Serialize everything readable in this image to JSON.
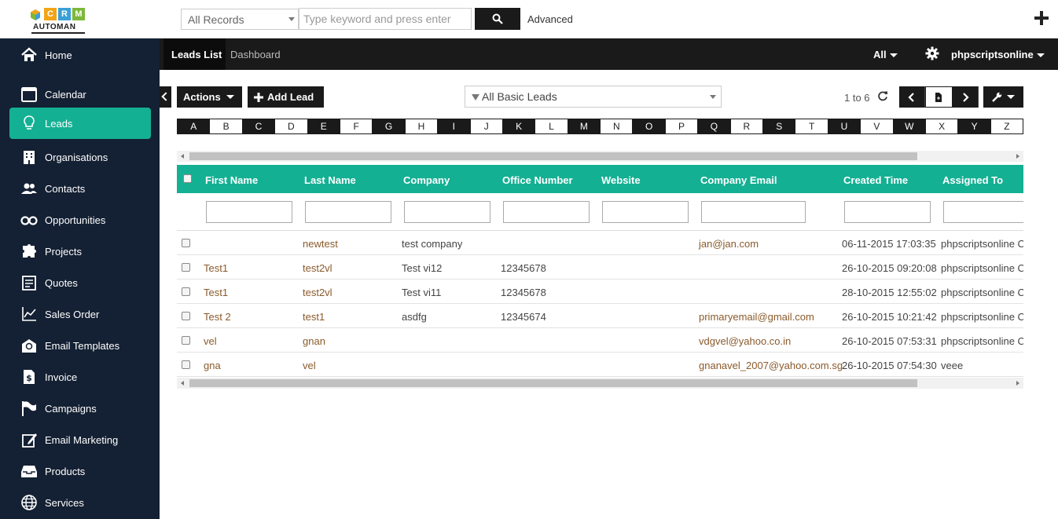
{
  "logo": {
    "crm_letters": [
      "C",
      "R",
      "M"
    ],
    "subtitle": "AUTOMAN",
    "colors": [
      "#f2a517",
      "#3aa0d8",
      "#7db83a"
    ]
  },
  "search": {
    "scope": "All Records",
    "placeholder": "Type keyword and press enter",
    "advanced_label": "Advanced"
  },
  "sidebar": {
    "items": [
      {
        "label": "Home",
        "icon": "home-icon"
      },
      {
        "label": "Calendar",
        "icon": "calendar-icon"
      },
      {
        "label": "Leads",
        "icon": "lightbulb-icon",
        "active": true
      },
      {
        "label": "Organisations",
        "icon": "building-icon"
      },
      {
        "label": "Contacts",
        "icon": "users-icon"
      },
      {
        "label": "Opportunities",
        "icon": "binoculars-icon"
      },
      {
        "label": "Projects",
        "icon": "puzzle-icon"
      },
      {
        "label": "Quotes",
        "icon": "quote-doc-icon"
      },
      {
        "label": "Sales Order",
        "icon": "chart-line-icon"
      },
      {
        "label": "Email Templates",
        "icon": "email-template-icon"
      },
      {
        "label": "Invoice",
        "icon": "invoice-icon"
      },
      {
        "label": "Campaigns",
        "icon": "flag-icon"
      },
      {
        "label": "Email Marketing",
        "icon": "edit-icon"
      },
      {
        "label": "Products",
        "icon": "inbox-icon"
      },
      {
        "label": "Services",
        "icon": "globe-icon"
      }
    ]
  },
  "navbar": {
    "tabs": [
      "Leads List",
      "Dashboard"
    ],
    "all_label": "All",
    "user": "phpscriptsonline"
  },
  "toolbar": {
    "actions_label": "Actions",
    "add_lead_label": "Add Lead",
    "filter_value": "All Basic Leads",
    "range_label": "1 to 6"
  },
  "alphabet": [
    "A",
    "B",
    "C",
    "D",
    "E",
    "F",
    "G",
    "H",
    "I",
    "J",
    "K",
    "L",
    "M",
    "N",
    "O",
    "P",
    "Q",
    "R",
    "S",
    "T",
    "U",
    "V",
    "W",
    "X",
    "Y",
    "Z"
  ],
  "table": {
    "columns": [
      "First Name",
      "Last Name",
      "Company",
      "Office Number",
      "Website",
      "Company Email",
      "Created Time",
      "Assigned To"
    ],
    "rows": [
      [
        "",
        "newtest",
        "test company",
        "",
        "",
        "jan@jan.com",
        "06-11-2015 17:03:35",
        "phpscriptsonline C"
      ],
      [
        "Test1",
        "test2vl",
        "Test vi12",
        "12345678",
        "",
        "",
        "26-10-2015 09:20:08",
        "phpscriptsonline C"
      ],
      [
        "Test1",
        "test2vl",
        "Test vi11",
        "12345678",
        "",
        "",
        "28-10-2015 12:55:02",
        "phpscriptsonline C"
      ],
      [
        "Test 2",
        "test1",
        "asdfg",
        "12345674",
        "",
        "primaryemail@gmail.com",
        "26-10-2015 10:21:42",
        "phpscriptsonline C"
      ],
      [
        "vel",
        "gnan",
        "",
        "",
        "",
        "vdgvel@yahoo.co.in",
        "26-10-2015 07:53:31",
        "phpscriptsonline C"
      ],
      [
        "gna",
        "vel",
        "",
        "",
        "",
        "gnanavel_2007@yahoo.com.sg",
        "26-10-2015 07:54:30",
        "veee"
      ]
    ]
  },
  "colors": {
    "accent": "#14b093",
    "sidebar_bg": "#142033",
    "dark": "#1a1a1a",
    "link": "#8a5a2b"
  }
}
